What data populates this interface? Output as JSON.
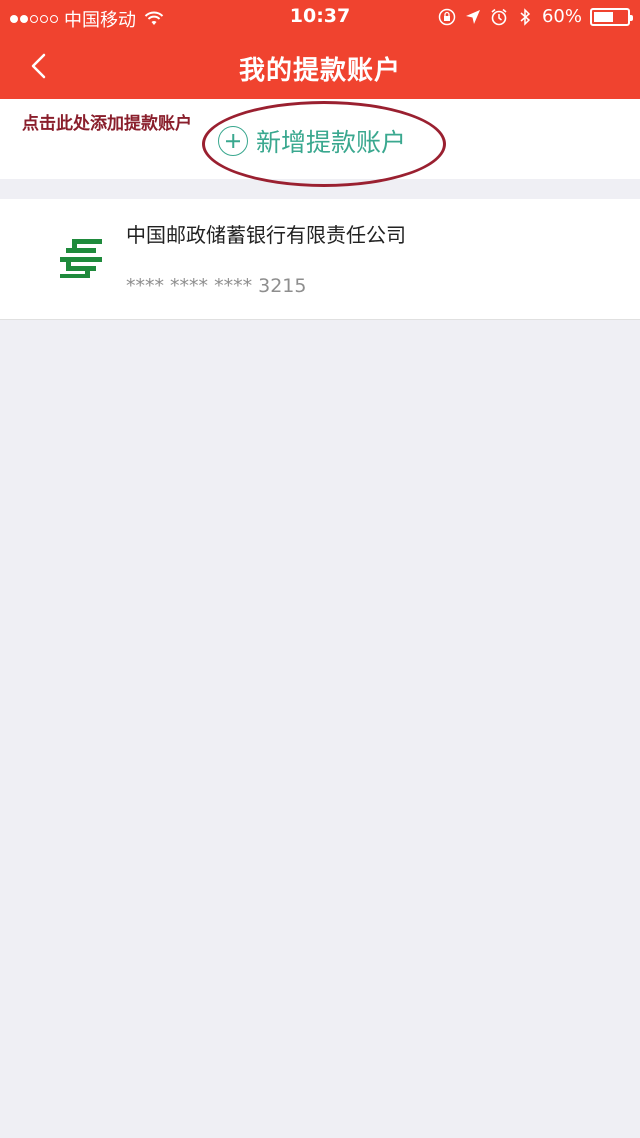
{
  "status_bar": {
    "carrier": "中国移动",
    "time": "10:37",
    "battery": "60%",
    "battery_level": 0.6,
    "icons": [
      "wifi-icon",
      "orientation-lock-icon",
      "location-arrow-icon",
      "alarm-icon",
      "bluetooth-icon",
      "battery-icon"
    ]
  },
  "nav": {
    "title": "我的提款账户",
    "back_icon": "chevron-left-icon"
  },
  "add_section": {
    "annotation": "点击此处添加提款账户",
    "button_label": "新增提款账户",
    "button_icon": "plus-circle-icon"
  },
  "accounts": [
    {
      "bank_name": "中国邮政储蓄银行有限责任公司",
      "card_number": "**** **** **** 3215",
      "logo_icon": "postal-bank-logo-icon"
    }
  ],
  "colors": {
    "header": "#f0432f",
    "accent": "#3aa88f",
    "annotation": "#8a1f2c",
    "logo": "#1f8a3c",
    "background": "#efeff4"
  }
}
